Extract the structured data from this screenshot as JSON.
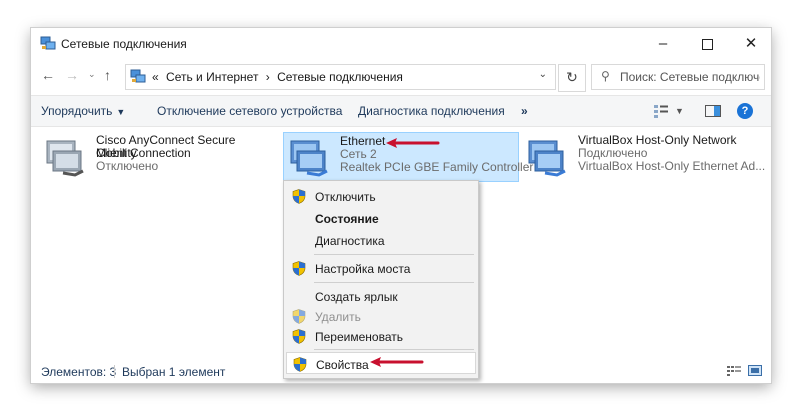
{
  "window": {
    "title": "Сетевые подключения",
    "controls": {
      "minimize": "–",
      "close": "✕"
    }
  },
  "address": {
    "nav_back": "←",
    "nav_forward": "→",
    "nav_recent": "⌄",
    "nav_up": "↑",
    "prefix": "«",
    "crumb1": "Сеть и Интернет",
    "sep": "›",
    "crumb2": "Сетевые подключения",
    "dropdown": "⌄",
    "refresh": "↻",
    "search_placeholder": "Поиск: Сетевые подключе..."
  },
  "toolbar": {
    "organize": "Упорядочить",
    "disconnect": "Отключение сетевого устройства",
    "diagnose": "Диагностика подключения",
    "more": "»",
    "help": "?"
  },
  "connections": [
    {
      "name_line1": "Cisco AnyConnect Secure Mobility",
      "name_line2": "Client Connection",
      "status": "Отключено"
    },
    {
      "name": "Ethernet",
      "network": "Сеть 2",
      "device": "Realtek PCIe GBE Family Controller"
    },
    {
      "name": "VirtualBox Host-Only Network",
      "status": "Подключено",
      "device": "VirtualBox Host-Only Ethernet Ad..."
    }
  ],
  "context_menu": {
    "items": [
      {
        "label": "Отключить"
      },
      {
        "label": "Состояние"
      },
      {
        "label": "Диагностика"
      },
      {
        "label": "Настройка моста"
      },
      {
        "label": "Создать ярлык"
      },
      {
        "label": "Удалить"
      },
      {
        "label": "Переименовать"
      },
      {
        "label": "Свойства"
      }
    ]
  },
  "status": {
    "count": "Элементов: 3",
    "selected": "Выбран 1 элемент"
  },
  "colors": {
    "selection_bg": "#cce8ff",
    "link_blue": "#1e395b",
    "annotation_red": "#c8102e",
    "shield_blue": "#2b6fd1",
    "shield_yellow": "#f2c200"
  }
}
